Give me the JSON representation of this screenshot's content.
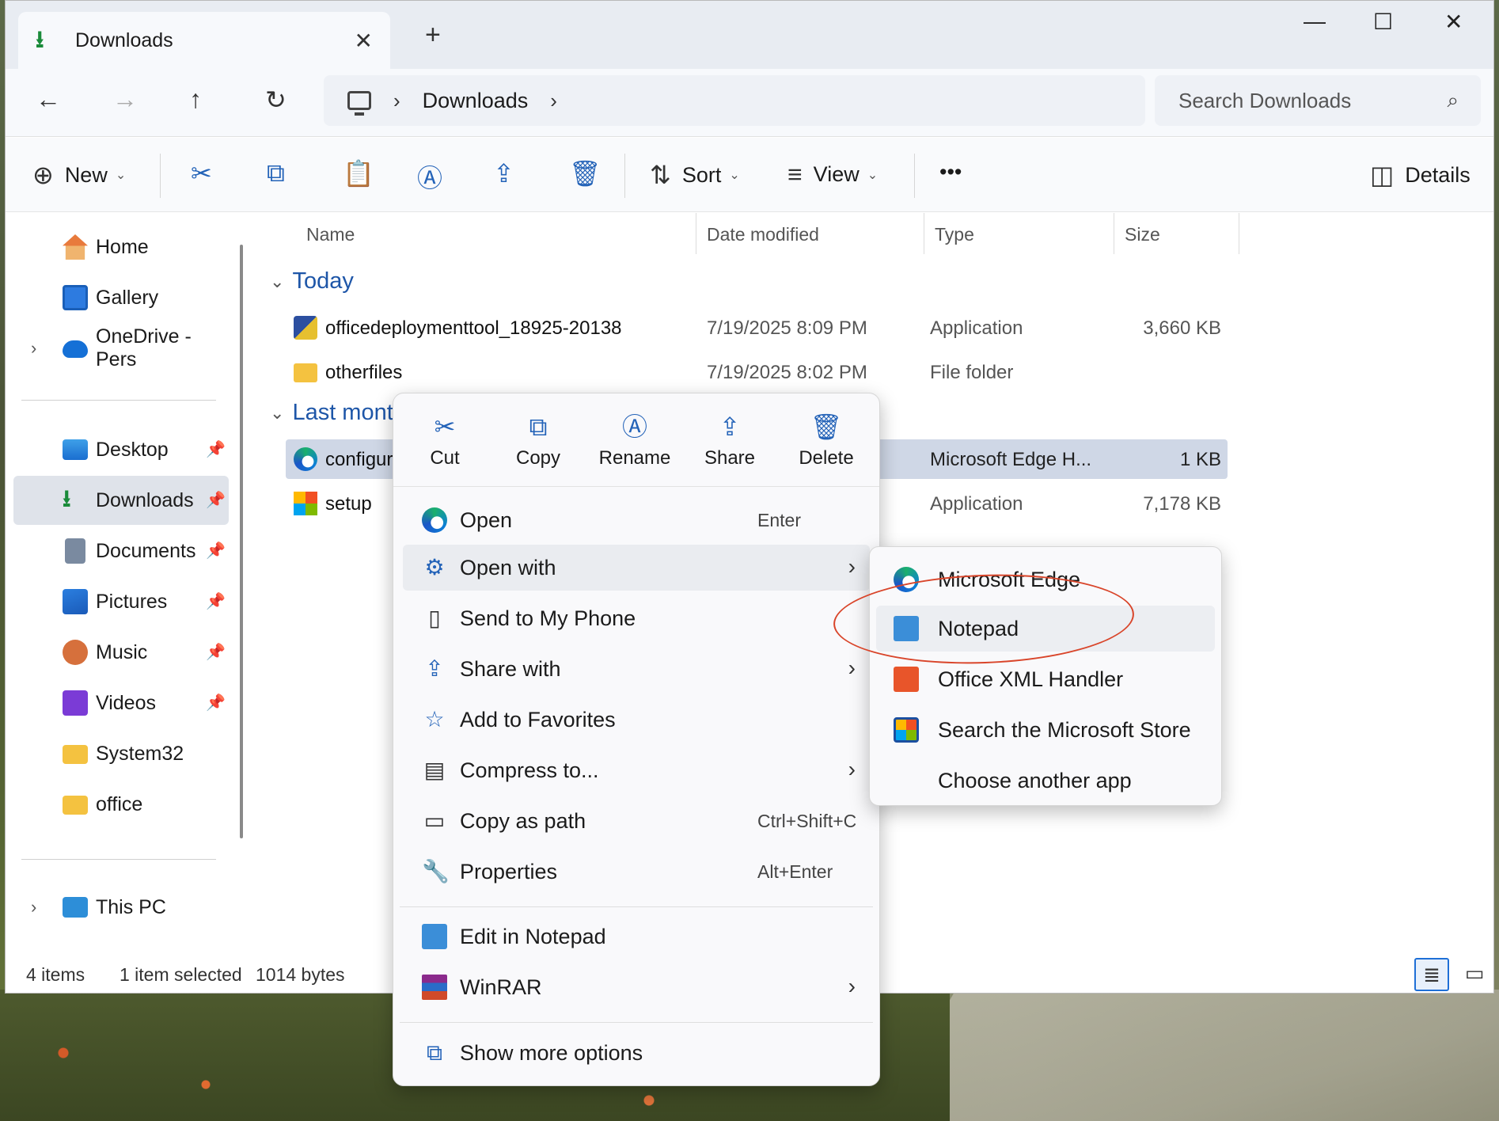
{
  "window": {
    "tab_title": "Downloads",
    "tab_close": "✕",
    "new_tab": "+"
  },
  "window_controls": {
    "minimize": "—",
    "maximize": "☐",
    "close": "✕"
  },
  "address": {
    "crumbs": [
      "Downloads"
    ],
    "search_placeholder": "Search Downloads"
  },
  "toolbar": {
    "new_label": "New",
    "sort_label": "Sort",
    "view_label": "View",
    "more_label": "•••",
    "details_label": "Details"
  },
  "sidebar": {
    "items": [
      {
        "label": "Home",
        "icon": "home-icon"
      },
      {
        "label": "Gallery",
        "icon": "gallery-icon"
      },
      {
        "label": "OneDrive - Pers",
        "icon": "onedrive-icon"
      },
      {
        "label": "Desktop",
        "icon": "desktop-icon"
      },
      {
        "label": "Downloads",
        "icon": "downloads-icon"
      },
      {
        "label": "Documents",
        "icon": "documents-icon"
      },
      {
        "label": "Pictures",
        "icon": "pictures-icon"
      },
      {
        "label": "Music",
        "icon": "music-icon"
      },
      {
        "label": "Videos",
        "icon": "videos-icon"
      },
      {
        "label": "System32",
        "icon": "folder-icon"
      },
      {
        "label": "office",
        "icon": "folder-icon"
      },
      {
        "label": "This PC",
        "icon": "pc-icon"
      }
    ]
  },
  "columns": {
    "name": "Name",
    "date": "Date modified",
    "type": "Type",
    "size": "Size"
  },
  "groups": {
    "today": "Today",
    "last_month": "Last mont"
  },
  "files": [
    {
      "name": "officedeploymenttool_18925-20138",
      "date": "7/19/2025 8:09 PM",
      "type": "Application",
      "size": "3,660 KB"
    },
    {
      "name": "otherfiles",
      "date": "7/19/2025 8:02 PM",
      "type": "File folder",
      "size": ""
    },
    {
      "name": "configura",
      "date": "",
      "type": "Microsoft Edge H...",
      "size": "1 KB"
    },
    {
      "name": "setup",
      "date": "",
      "type": "Application",
      "size": "7,178 KB"
    }
  ],
  "status": {
    "count": "4 items",
    "selection": "1 item selected",
    "bytes": "1014 bytes"
  },
  "context_menu": {
    "actions": {
      "cut": "Cut",
      "copy": "Copy",
      "rename": "Rename",
      "share": "Share",
      "delete": "Delete"
    },
    "items": [
      {
        "label": "Open",
        "shortcut": "Enter"
      },
      {
        "label": "Open with",
        "shortcut": ""
      },
      {
        "label": "Send to My Phone",
        "shortcut": ""
      },
      {
        "label": "Share with",
        "shortcut": ""
      },
      {
        "label": "Add to Favorites",
        "shortcut": ""
      },
      {
        "label": "Compress to...",
        "shortcut": ""
      },
      {
        "label": "Copy as path",
        "shortcut": "Ctrl+Shift+C"
      },
      {
        "label": "Properties",
        "shortcut": "Alt+Enter"
      },
      {
        "label": "Edit in Notepad",
        "shortcut": ""
      },
      {
        "label": "WinRAR",
        "shortcut": ""
      },
      {
        "label": "Show more options",
        "shortcut": ""
      }
    ]
  },
  "open_with_submenu": {
    "items": [
      {
        "label": "Microsoft Edge"
      },
      {
        "label": "Notepad"
      },
      {
        "label": "Office XML Handler"
      },
      {
        "label": "Search the Microsoft Store"
      },
      {
        "label": "Choose another app"
      }
    ]
  },
  "colors": {
    "accent": "#2463b8",
    "group_header": "#1e56a8",
    "selection": "#cfd7e6",
    "annotation": "#d9452a"
  }
}
